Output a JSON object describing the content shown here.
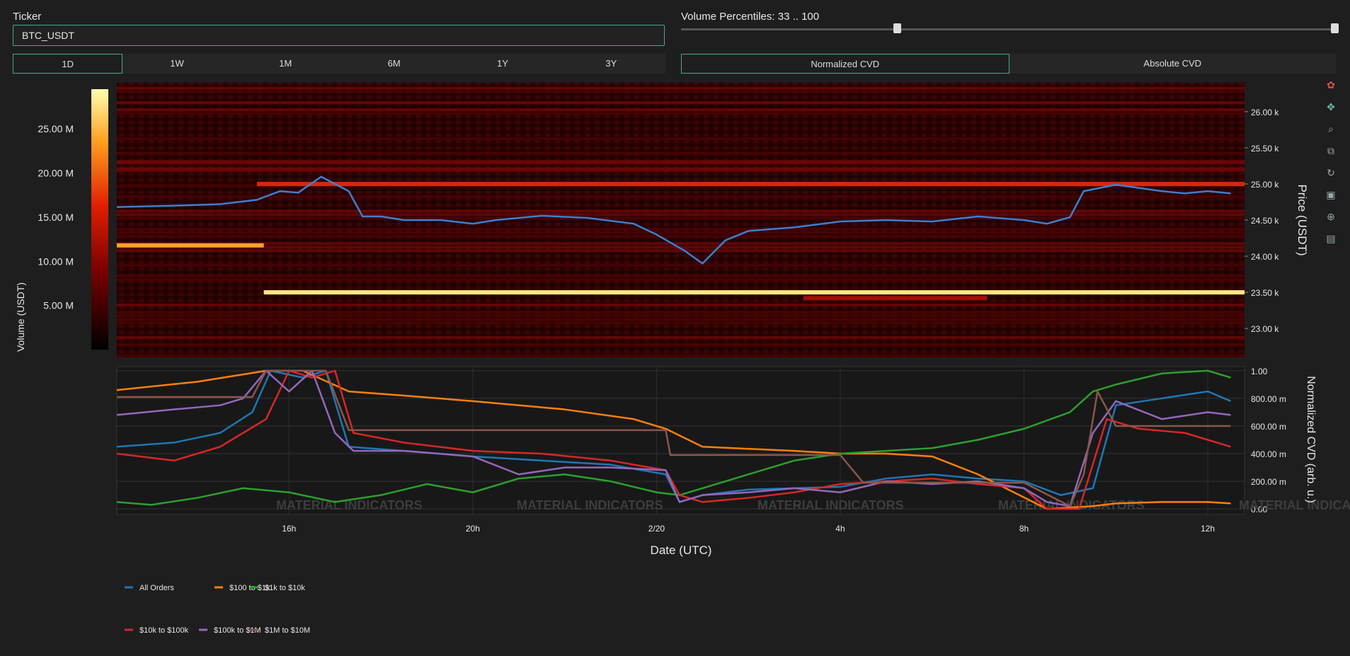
{
  "ticker": {
    "label": "Ticker",
    "value": "BTC_USDT"
  },
  "timeframes": {
    "items": [
      "1D",
      "1W",
      "1M",
      "6M",
      "1Y",
      "3Y"
    ],
    "active": "1D"
  },
  "volume_percentiles": {
    "label": "Volume Percentiles: 33 .. 100",
    "low": 33,
    "high": 100
  },
  "cvd_modes": {
    "items": [
      "Normalized CVD",
      "Absolute CVD"
    ],
    "active": "Normalized CVD"
  },
  "colorbar": {
    "title": "Volume (USDT)",
    "ticks": [
      "5.00 M",
      "10.00 M",
      "15.00 M",
      "20.00 M",
      "25.00 M"
    ],
    "tick_values": [
      5,
      10,
      15,
      20,
      25
    ],
    "max": 29.5
  },
  "watermark": "MATERIAL INDICATORS",
  "modebar_icons": [
    "plotly-logo-icon",
    "pan-icon",
    "zoom-icon",
    "compare-icon",
    "reset-icon",
    "save-icon",
    "crosshair-icon",
    "hover-icon"
  ],
  "chart_data": [
    {
      "type": "heatmap",
      "title": "",
      "ylabel": "Price (USDT)",
      "ylim": [
        22600,
        26400
      ],
      "yticks": [
        "23.00 k",
        "23.50 k",
        "24.00 k",
        "24.50 k",
        "25.00 k",
        "25.50 k",
        "26.00 k"
      ],
      "ytick_values": [
        23000,
        23500,
        24000,
        24500,
        25000,
        25500,
        26000
      ],
      "bands": [
        {
          "price": 25000,
          "volume_m": 16,
          "from_h": 15.3,
          "to_h": 36.8
        },
        {
          "price": 24150,
          "volume_m": 21,
          "from_h": 12.25,
          "to_h": 15.45
        },
        {
          "price": 23500,
          "volume_m": 27,
          "from_h": 15.45,
          "to_h": 36.8
        },
        {
          "price": 23420,
          "volume_m": 8,
          "from_h": 27.2,
          "to_h": 31.2
        },
        {
          "price": 25200,
          "volume_m": 7,
          "from_h": 12.25,
          "to_h": 36.8
        },
        {
          "price": 25300,
          "volume_m": 6,
          "from_h": 12.25,
          "to_h": 36.8
        }
      ],
      "series": [
        {
          "name": "Price",
          "x_h": [
            12.25,
            13.5,
            14.5,
            15.3,
            15.8,
            16.2,
            16.7,
            17.3,
            17.6,
            18.0,
            18.5,
            19.3,
            20.0,
            20.5,
            21.5,
            22.5,
            23.5,
            24.0,
            24.6,
            25.0,
            25.5,
            26.0,
            27.0,
            28.0,
            29.0,
            30.0,
            31.0,
            32.0,
            32.5,
            33.0,
            33.3,
            34.0,
            35.0,
            35.5,
            36.0,
            36.5
          ],
          "y": [
            24680,
            24700,
            24720,
            24780,
            24900,
            24880,
            25100,
            24900,
            24550,
            24550,
            24500,
            24500,
            24450,
            24500,
            24560,
            24530,
            24450,
            24300,
            24080,
            23900,
            24220,
            24350,
            24400,
            24480,
            24500,
            24480,
            24550,
            24500,
            24450,
            24540,
            24900,
            24990,
            24900,
            24870,
            24900,
            24870
          ]
        }
      ]
    },
    {
      "type": "line",
      "title": "",
      "xlabel": "Date (UTC)",
      "ylabel": "Normalized CVD (arb. u.)",
      "ylim": [
        -0.04,
        1.03
      ],
      "yticks": [
        "0.00",
        "200.00 m",
        "400.00 m",
        "600.00 m",
        "800.00 m",
        "1.00"
      ],
      "ytick_values": [
        0,
        0.2,
        0.4,
        0.6,
        0.8,
        1.0
      ],
      "xlim": [
        12.25,
        36.8
      ],
      "xticks": [
        "16h",
        "20h",
        "2/20",
        "4h",
        "8h",
        "12h"
      ],
      "xtick_values": [
        16,
        20,
        24,
        28,
        32,
        36
      ],
      "series": [
        {
          "name": "All Orders",
          "color": "#1f77b4",
          "x": [
            12.25,
            13.5,
            14.5,
            15.2,
            15.6,
            16.3,
            16.8,
            17.3,
            18.5,
            20.0,
            21.5,
            23.0,
            24.2,
            24.5,
            25.0,
            26.0,
            27.0,
            28.0,
            29.0,
            30.0,
            31.0,
            32.0,
            32.8,
            33.5,
            34.0,
            35.0,
            36.0,
            36.5
          ],
          "y": [
            0.45,
            0.48,
            0.55,
            0.7,
            1.0,
            0.95,
            1.0,
            0.45,
            0.42,
            0.38,
            0.35,
            0.32,
            0.25,
            0.05,
            0.1,
            0.14,
            0.15,
            0.16,
            0.22,
            0.25,
            0.22,
            0.2,
            0.1,
            0.15,
            0.75,
            0.8,
            0.85,
            0.78
          ]
        },
        {
          "name": "$100 to $1k",
          "color": "#ff7f0e",
          "x": [
            12.25,
            14.0,
            15.5,
            16.3,
            17.3,
            18.5,
            20.0,
            22.0,
            23.5,
            24.2,
            25.0,
            27.0,
            28.0,
            29.0,
            30.0,
            31.0,
            32.5,
            33.5,
            34.0,
            35.0,
            36.0,
            36.5
          ],
          "y": [
            0.86,
            0.92,
            1.0,
            1.0,
            0.85,
            0.82,
            0.78,
            0.72,
            0.65,
            0.58,
            0.45,
            0.42,
            0.4,
            0.4,
            0.38,
            0.25,
            0.0,
            0.02,
            0.04,
            0.05,
            0.05,
            0.04
          ]
        },
        {
          "name": "$1k to $10k",
          "color": "#2ca02c",
          "x": [
            12.25,
            13.0,
            14.0,
            15.0,
            16.0,
            17.0,
            18.0,
            19.0,
            20.0,
            21.0,
            22.0,
            23.0,
            24.0,
            24.5,
            25.0,
            26.0,
            27.0,
            28.0,
            29.0,
            30.0,
            31.0,
            32.0,
            33.0,
            33.5,
            34.0,
            35.0,
            36.0,
            36.5
          ],
          "y": [
            0.05,
            0.03,
            0.08,
            0.15,
            0.12,
            0.05,
            0.1,
            0.18,
            0.12,
            0.22,
            0.25,
            0.2,
            0.12,
            0.1,
            0.15,
            0.25,
            0.35,
            0.4,
            0.42,
            0.44,
            0.5,
            0.58,
            0.7,
            0.85,
            0.9,
            0.98,
            1.0,
            0.95
          ]
        },
        {
          "name": "$10k to $100k",
          "color": "#d62728",
          "x": [
            12.25,
            13.5,
            14.5,
            15.0,
            15.5,
            16.0,
            16.5,
            17.0,
            17.4,
            18.5,
            20.0,
            21.5,
            23.0,
            24.2,
            24.5,
            25.0,
            26.0,
            27.0,
            28.0,
            29.0,
            30.0,
            31.0,
            32.0,
            32.5,
            33.2,
            33.8,
            34.5,
            35.5,
            36.5
          ],
          "y": [
            0.4,
            0.35,
            0.45,
            0.55,
            0.65,
            1.0,
            0.95,
            1.0,
            0.55,
            0.48,
            0.42,
            0.4,
            0.35,
            0.28,
            0.1,
            0.05,
            0.08,
            0.12,
            0.18,
            0.2,
            0.22,
            0.18,
            0.15,
            0.0,
            0.0,
            0.65,
            0.58,
            0.55,
            0.45
          ]
        },
        {
          "name": "$100k to $1M",
          "color": "#9467bd",
          "x": [
            12.25,
            13.5,
            14.5,
            15.0,
            15.5,
            16.0,
            16.5,
            17.0,
            17.4,
            18.5,
            20.0,
            21.0,
            22.0,
            23.0,
            24.2,
            24.5,
            25.0,
            26.0,
            27.0,
            28.0,
            29.0,
            30.0,
            31.0,
            32.0,
            32.5,
            33.0,
            33.5,
            34.0,
            35.0,
            36.0,
            36.5
          ],
          "y": [
            0.68,
            0.72,
            0.75,
            0.8,
            1.0,
            0.85,
            1.0,
            0.55,
            0.42,
            0.42,
            0.38,
            0.25,
            0.3,
            0.3,
            0.28,
            0.05,
            0.1,
            0.12,
            0.15,
            0.12,
            0.2,
            0.18,
            0.2,
            0.15,
            0.05,
            0.02,
            0.55,
            0.78,
            0.65,
            0.7,
            0.68
          ]
        },
        {
          "name": "$1M to $10M",
          "color": "#8c564b",
          "x": [
            12.25,
            15.2,
            15.5,
            16.5,
            16.8,
            17.3,
            18.0,
            23.0,
            24.2,
            24.3,
            27.5,
            28.0,
            28.5,
            31.0,
            32.0,
            33.0,
            33.3,
            33.6,
            34.0,
            36.5
          ],
          "y": [
            0.81,
            0.81,
            1.0,
            1.0,
            1.0,
            0.57,
            0.57,
            0.57,
            0.57,
            0.39,
            0.39,
            0.39,
            0.19,
            0.19,
            0.19,
            0.02,
            0.25,
            0.85,
            0.6,
            0.6
          ]
        }
      ]
    }
  ]
}
